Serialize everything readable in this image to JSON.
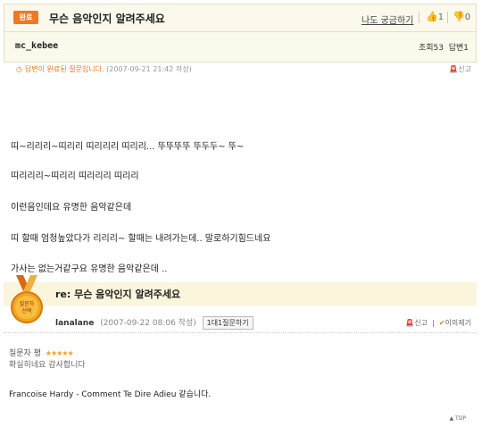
{
  "question": {
    "status_badge": "완료",
    "title": "무슨 음악인지 알려주세요",
    "me_too_label": "나도 궁금하기",
    "like_count": "1",
    "dislike_count": "0",
    "author": "mc_kebee",
    "views": "조회53",
    "answers": "답변1",
    "status_text_prefix": "답변이 완료된 질문입니다.",
    "status_timestamp": "(2007-09-21 21:42 작성)",
    "report_label": "신고",
    "body_lines": [
      "띠~리리리~띠리리  띠리리리 띠리리... 뚜뚜뚜뚜 뚜두두~  뚜~",
      "띠리리리~띠리리 띠리리리 띠리리",
      "이런음인데요 유명한 음악같은데",
      "띠 할때 엄청높았다가 리리리~  할때는 내려가는데.. 말로하기힘드네요",
      "가사는 없는거같구요 유명한 음악같은데 .."
    ]
  },
  "answer": {
    "medal_text": [
      "질문자",
      "선택"
    ],
    "title": "re: 무슨 음악인지 알려주세요",
    "author": "lanalane",
    "timestamp": "(2007-09-22 08:06 작성)",
    "ask_button_label": "1대1질문하기",
    "report_label": "신고",
    "agree_label": "이의제기",
    "rating_label": "질문자 평",
    "stars": "★★★★★",
    "rating_comment": "확실히네요 감사합니다",
    "text": "Francoise Hardy - Comment Te Dire Adieu 같습니다.",
    "top_link": "▲ TOP"
  },
  "colors": {
    "accent": "#ee7a21",
    "header_bg": "#fbf8ec",
    "answer_bar_bg": "#fbf5dc"
  }
}
